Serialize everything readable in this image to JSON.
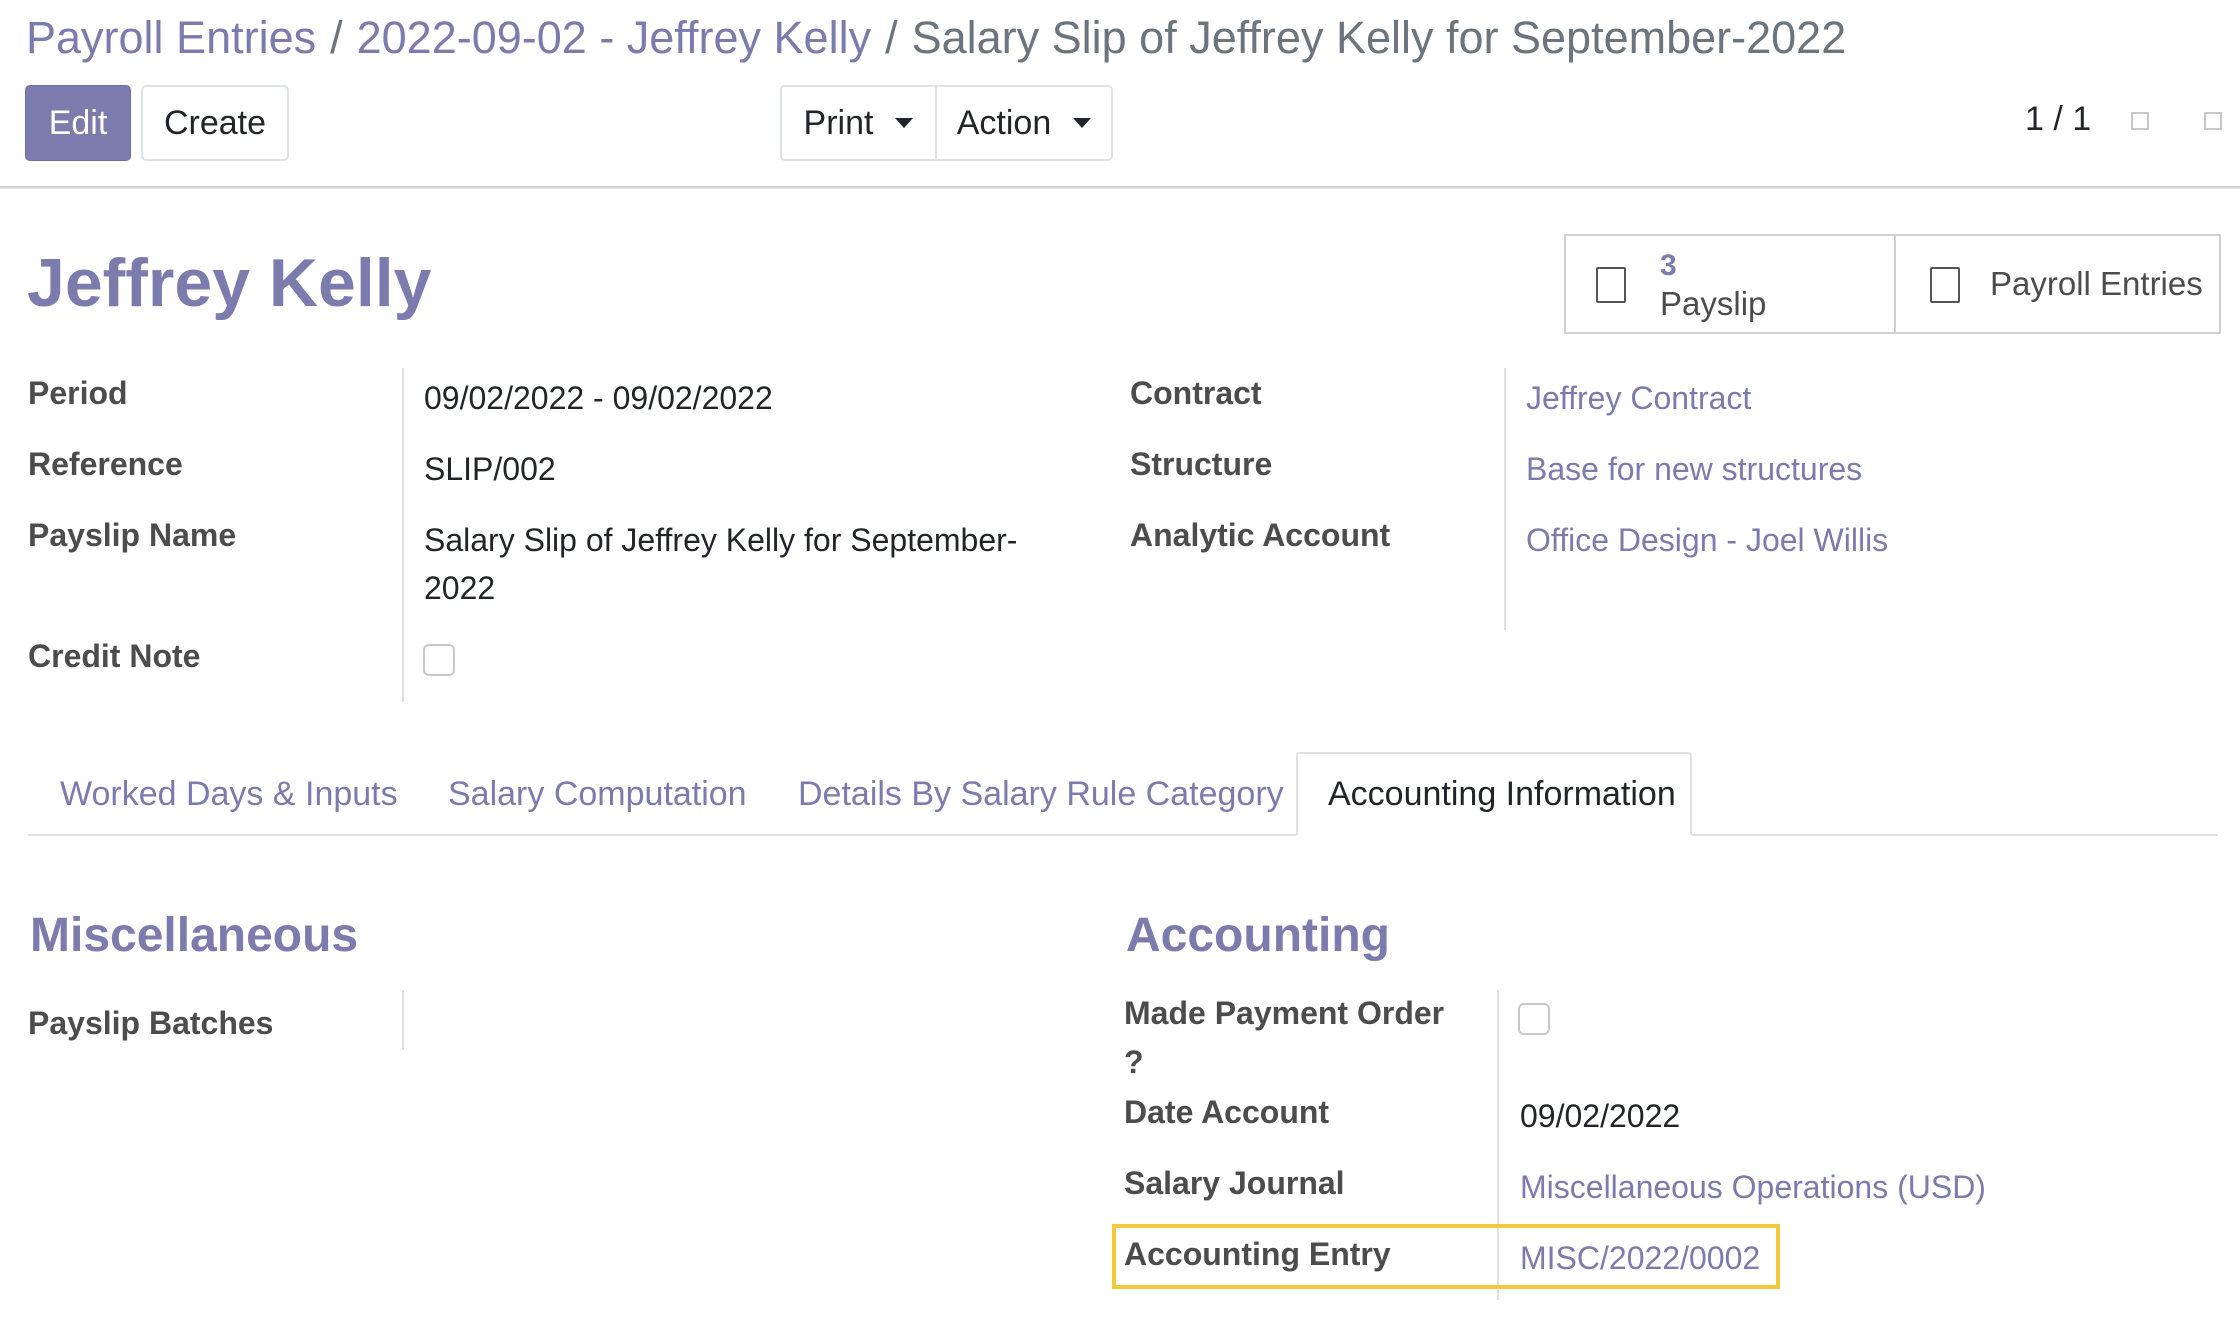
{
  "breadcrumb": {
    "items": [
      "Payroll Entries",
      "2022-09-02 - Jeffrey Kelly"
    ],
    "separator": "/",
    "current": "Salary Slip of Jeffrey Kelly for September-2022"
  },
  "toolbar": {
    "edit_label": "Edit",
    "create_label": "Create",
    "print_label": "Print",
    "action_label": "Action",
    "pager": "1 / 1"
  },
  "employee": {
    "name": "Jeffrey Kelly"
  },
  "smart_buttons": {
    "payslip": {
      "count": "3",
      "label": "Payslip",
      "icon": "payslip-icon"
    },
    "payroll_entries": {
      "label": "Payroll Entries",
      "icon": "payroll-entries-icon"
    }
  },
  "fields_left": {
    "period": {
      "label": "Period",
      "value": "09/02/2022 - 09/02/2022"
    },
    "reference": {
      "label": "Reference",
      "value": "SLIP/002"
    },
    "payslip_name": {
      "label": "Payslip Name",
      "value": "Salary Slip of Jeffrey Kelly for September-2022"
    },
    "credit_note": {
      "label": "Credit Note",
      "checked": false
    }
  },
  "fields_right": {
    "contract": {
      "label": "Contract",
      "value": "Jeffrey Contract"
    },
    "structure": {
      "label": "Structure",
      "value": "Base for new structures"
    },
    "analytic_account": {
      "label": "Analytic Account",
      "value": "Office Design - Joel Willis"
    }
  },
  "tabs": [
    {
      "label": "Worked Days & Inputs",
      "active": false
    },
    {
      "label": "Salary Computation",
      "active": false
    },
    {
      "label": "Details By Salary Rule Category",
      "active": false
    },
    {
      "label": "Accounting Information",
      "active": true
    }
  ],
  "miscellaneous": {
    "title": "Miscellaneous",
    "payslip_batches": {
      "label": "Payslip Batches",
      "value": ""
    }
  },
  "accounting": {
    "title": "Accounting",
    "made_payment_order": {
      "label_line1": "Made Payment Order",
      "label_line2": "?",
      "checked": false
    },
    "date_account": {
      "label": "Date Account",
      "value": "09/02/2022"
    },
    "salary_journal": {
      "label": "Salary Journal",
      "value": "Miscellaneous Operations (USD)"
    },
    "accounting_entry": {
      "label": "Accounting Entry",
      "value": "MISC/2022/0002"
    }
  },
  "colors": {
    "brand": "#7c7bad",
    "highlight": "#f1c93b",
    "label_text": "#4c4c4c"
  }
}
